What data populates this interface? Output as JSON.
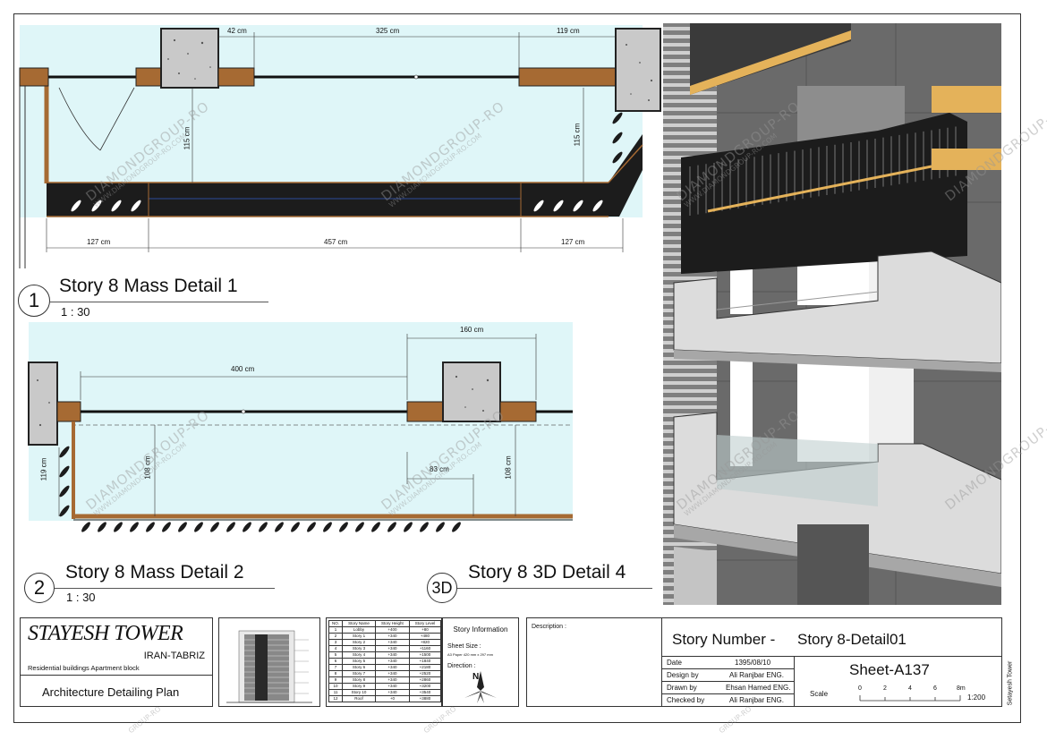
{
  "detail1": {
    "number": "1",
    "title": "Story 8 Mass Detail 1",
    "scale": "1 : 30",
    "dims": {
      "top_a": "42 cm",
      "top_b": "325 cm",
      "top_c": "119 cm",
      "left_h": "115 cm",
      "right_h": "115 cm",
      "bot_a": "127 cm",
      "bot_b": "457 cm",
      "bot_c": "127 cm"
    }
  },
  "detail2": {
    "number": "2",
    "title": "Story 8 Mass Detail 2",
    "scale": "1 : 30",
    "dims": {
      "top_a": "160 cm",
      "mid_a": "400 cm",
      "left_h": "119 cm",
      "h1": "108 cm",
      "d83": "83 cm",
      "h2": "108 cm"
    }
  },
  "detail4": {
    "number": "3D",
    "title": "Story 8 3D Detail 4"
  },
  "watermark": {
    "main": "DIAMONDGROUP-RO",
    "sub": "WWW.DIAMONDGROUP-RO.COM",
    "edge": "GROUP-RO"
  },
  "title_block": {
    "project": "STAYESH TOWER",
    "location": "IRAN-TABRIZ",
    "subtitle": "Residential buildings Apartment block",
    "plan": "Architecture Detailing Plan",
    "story_info": {
      "heading": "Story Information",
      "sheet_size_label": "Sheet Size :",
      "sheet_size_value": "A3 Paper 420 mm x 297 mm",
      "direction_label": "Direction :",
      "north": "N"
    },
    "story_table": {
      "headers": [
        "NO.",
        "Story Name",
        "Story Height",
        "Story Level"
      ],
      "rows": [
        [
          "1",
          "Lobby",
          "+400",
          "+80"
        ],
        [
          "2",
          "Story 1",
          "+340",
          "+480"
        ],
        [
          "3",
          "Story 2",
          "+340",
          "+820"
        ],
        [
          "4",
          "Story 3",
          "+340",
          "+1160"
        ],
        [
          "5",
          "Story 4",
          "+340",
          "+1500"
        ],
        [
          "6",
          "Story 5",
          "+340",
          "+1840"
        ],
        [
          "7",
          "Story 6",
          "+340",
          "+2180"
        ],
        [
          "8",
          "Story 7",
          "+340",
          "+2520"
        ],
        [
          "9",
          "Story 8",
          "+340",
          "+2860"
        ],
        [
          "10",
          "Story 9",
          "+340",
          "+3200"
        ],
        [
          "11",
          "Story 10",
          "+340",
          "+3540"
        ],
        [
          "12",
          "Roof",
          "+0",
          "+3880"
        ]
      ]
    },
    "description_label": "Description :",
    "story_number_label": "Story Number -",
    "story_number_value": "Story 8-Detail01",
    "date_label": "Date",
    "date_value": "1395/08/10",
    "design_label": "Design by",
    "design_value": "Ali Ranjbar ENG.",
    "drawn_label": "Drawn by",
    "drawn_value": "Ehsan Hamed ENG.",
    "checked_label": "Checked by",
    "checked_value": "Ali Ranjbar ENG.",
    "sheet": "Sheet-A137",
    "scale_label": "Scale",
    "scale_ticks": [
      "0",
      "2",
      "4",
      "6",
      "8m"
    ],
    "scale_ratio": "1:200",
    "side_text": "Setayesh Tower"
  },
  "colors": {
    "glass": "#dff6f8",
    "wood": "#a66a33",
    "concrete": "#c9c9c9",
    "dark": "#1c1c1c"
  }
}
